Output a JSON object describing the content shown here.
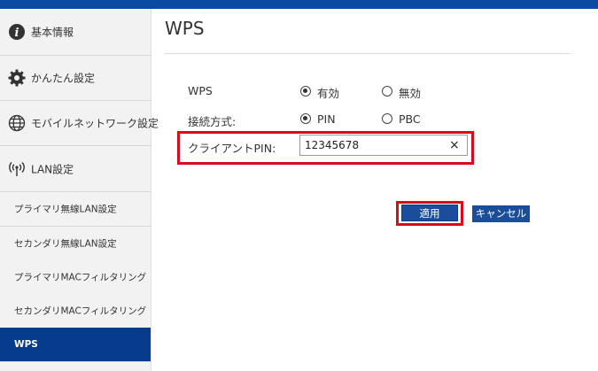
{
  "sidebar": {
    "main_items": [
      {
        "label": "基本情報",
        "icon": "info-icon"
      },
      {
        "label": "かんたん設定",
        "icon": "gear-icon"
      },
      {
        "label": "モバイルネットワーク設定",
        "icon": "globe-icon"
      },
      {
        "label": "LAN設定",
        "icon": "wireless-icon"
      }
    ],
    "sub_items": [
      {
        "label": "プライマリ無線LAN設定"
      },
      {
        "label": "セカンダリ無線LAN設定"
      },
      {
        "label": "プライマリMACフィルタリング"
      },
      {
        "label": "セカンダリMACフィルタリング"
      },
      {
        "label": "WPS",
        "active": true
      }
    ]
  },
  "main": {
    "title": "WPS",
    "wps": {
      "label": "WPS",
      "options": [
        {
          "label": "有効",
          "checked": true
        },
        {
          "label": "無効",
          "checked": false
        }
      ]
    },
    "connection_method": {
      "label": "接続方式:",
      "options": [
        {
          "label": "PIN",
          "checked": true
        },
        {
          "label": "PBC",
          "checked": false
        }
      ]
    },
    "client_pin": {
      "label": "クライアントPIN:",
      "value": "12345678",
      "clear_icon": "×"
    },
    "buttons": {
      "apply": "適用",
      "cancel": "キャンセル"
    }
  },
  "colors": {
    "brand": "#0b4aa3",
    "active_nav": "#073c8d",
    "button": "#1a4e9c",
    "highlight": "#d80c18"
  }
}
